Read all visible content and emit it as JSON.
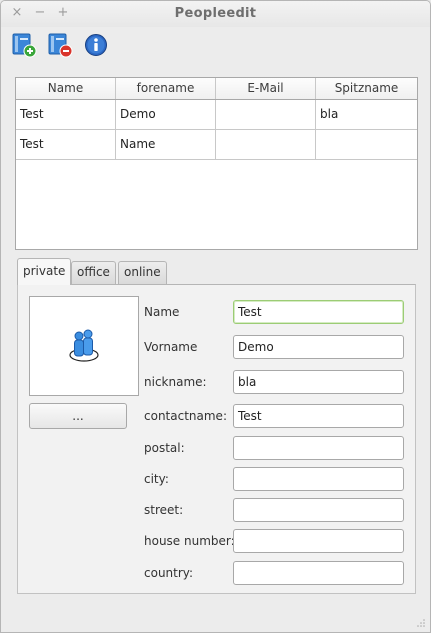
{
  "window": {
    "title": "Peopleedit",
    "controls": {
      "close": "×",
      "minimize": "−",
      "maximize": "+"
    }
  },
  "toolbar": {
    "buttons": [
      {
        "name": "add-person",
        "icon": "address-book-add-icon"
      },
      {
        "name": "remove-person",
        "icon": "address-book-remove-icon"
      },
      {
        "name": "info",
        "icon": "info-icon"
      }
    ]
  },
  "table": {
    "columns": [
      "Name",
      "forename",
      "E-Mail",
      "Spitzname"
    ],
    "rows": [
      [
        "Test",
        "Demo",
        "",
        "bla"
      ],
      [
        "Test",
        "Name",
        "",
        ""
      ]
    ]
  },
  "tabs": [
    {
      "label": "private",
      "active": true
    },
    {
      "label": "office",
      "active": false
    },
    {
      "label": "online",
      "active": false
    }
  ],
  "private": {
    "photo_icon": "people-icon",
    "browse_label": "...",
    "fields": [
      {
        "label": "Name",
        "value": "Test"
      },
      {
        "label": "Vorname",
        "value": "Demo"
      },
      {
        "label": "nickname:",
        "value": "bla"
      },
      {
        "label": "contactname:",
        "value": "Test"
      },
      {
        "label": "postal:",
        "value": ""
      },
      {
        "label": "city:",
        "value": ""
      },
      {
        "label": "street:",
        "value": ""
      },
      {
        "label": "house number:",
        "value": ""
      },
      {
        "label": "country:",
        "value": ""
      }
    ]
  },
  "colors": {
    "accent_focus": "#9ccc75",
    "icon_blue": "#2f7fd6",
    "add_green": "#3aa63a",
    "remove_red": "#d9342b"
  }
}
